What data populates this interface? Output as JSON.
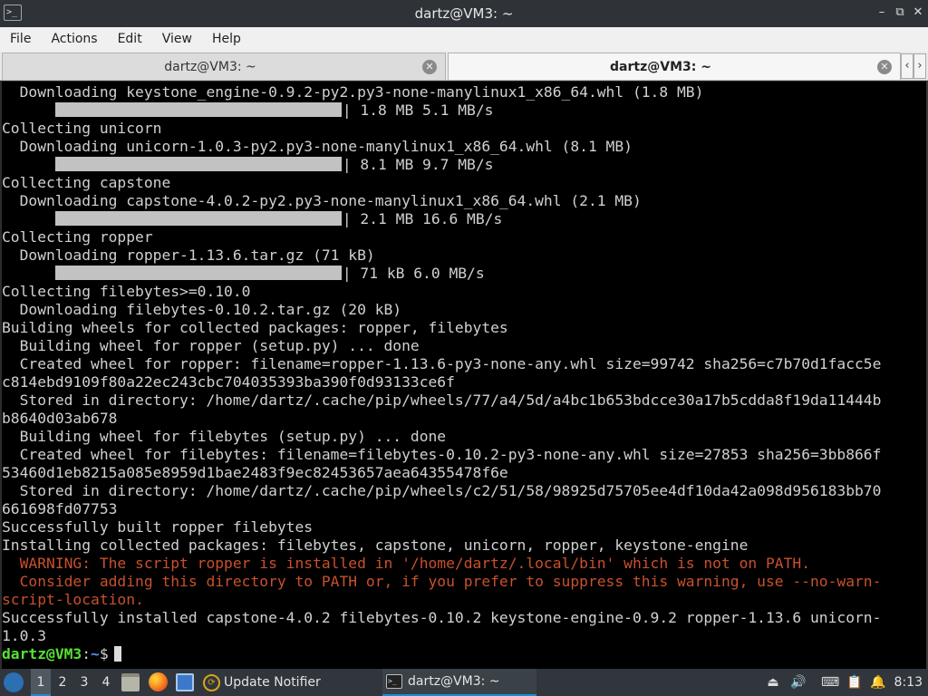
{
  "window": {
    "title": "dartz@VM3: ~",
    "controls": {
      "minimize": "–",
      "maximize": "⧉",
      "close": "✕"
    }
  },
  "menu": [
    "File",
    "Actions",
    "Edit",
    "View",
    "Help"
  ],
  "tabs": [
    {
      "label": "dartz@VM3: ~",
      "active": false
    },
    {
      "label": "dartz@VM3: ~",
      "active": true
    }
  ],
  "tab_nav": {
    "left": "‹",
    "right": "›"
  },
  "terminal": {
    "colors": {
      "background": "#000000",
      "text": "#d0d0d0",
      "warning": "#c8512b",
      "prompt_user": "#55e233",
      "prompt_path": "#5b8ef7"
    },
    "lines": [
      {
        "text": "  Downloading keystone_engine-0.9.2-py2.py3-none-manylinux1_x86_64.whl (1.8 MB)"
      },
      {
        "indent": "      ",
        "progress": 1.0,
        "text": "| 1.8 MB 5.1 MB/s"
      },
      {
        "text": "Collecting unicorn"
      },
      {
        "text": "  Downloading unicorn-1.0.3-py2.py3-none-manylinux1_x86_64.whl (8.1 MB)"
      },
      {
        "indent": "      ",
        "progress": 1.0,
        "text": "| 8.1 MB 9.7 MB/s"
      },
      {
        "text": "Collecting capstone"
      },
      {
        "text": "  Downloading capstone-4.0.2-py2.py3-none-manylinux1_x86_64.whl (2.1 MB)"
      },
      {
        "indent": "      ",
        "progress": 1.0,
        "text": "| 2.1 MB 16.6 MB/s"
      },
      {
        "text": "Collecting ropper"
      },
      {
        "text": "  Downloading ropper-1.13.6.tar.gz (71 kB)"
      },
      {
        "indent": "      ",
        "progress": 1.0,
        "text": "| 71 kB 6.0 MB/s"
      },
      {
        "text": "Collecting filebytes>=0.10.0"
      },
      {
        "text": "  Downloading filebytes-0.10.2.tar.gz (20 kB)"
      },
      {
        "text": "Building wheels for collected packages: ropper, filebytes"
      },
      {
        "text": "  Building wheel for ropper (setup.py) ... done"
      },
      {
        "text": "  Created wheel for ropper: filename=ropper-1.13.6-py3-none-any.whl size=99742 sha256=c7b70d1facc5e"
      },
      {
        "text": "c814ebd9109f80a22ec243cbc704035393ba390f0d93133ce6f"
      },
      {
        "text": "  Stored in directory: /home/dartz/.cache/pip/wheels/77/a4/5d/a4bc1b653bdcce30a17b5cdda8f19da11444b"
      },
      {
        "text": "b8640d03ab678"
      },
      {
        "text": "  Building wheel for filebytes (setup.py) ... done"
      },
      {
        "text": "  Created wheel for filebytes: filename=filebytes-0.10.2-py3-none-any.whl size=27853 sha256=3bb866f"
      },
      {
        "text": "53460d1eb8215a085e8959d1bae2483f9ec82453657aea64355478f6e"
      },
      {
        "text": "  Stored in directory: /home/dartz/.cache/pip/wheels/c2/51/58/98925d75705ee4df10da42a098d956183bb70"
      },
      {
        "text": "661698fd07753"
      },
      {
        "text": "Successfully built ropper filebytes"
      },
      {
        "text": "Installing collected packages: filebytes, capstone, unicorn, ropper, keystone-engine"
      },
      {
        "type": "warning",
        "text": "  WARNING: The script ropper is installed in '/home/dartz/.local/bin' which is not on PATH."
      },
      {
        "type": "warning",
        "text": "  Consider adding this directory to PATH or, if you prefer to suppress this warning, use --no-warn-"
      },
      {
        "type": "warning",
        "text": "script-location."
      },
      {
        "text": "Successfully installed capstone-4.0.2 filebytes-0.10.2 keystone-engine-0.9.2 ropper-1.13.6 unicorn-"
      },
      {
        "text": "1.0.3"
      }
    ],
    "prompt": {
      "user_host": "dartz@VM3",
      "separator": ":",
      "path": "~",
      "symbol": "$"
    }
  },
  "taskbar": {
    "workspaces": [
      "1",
      "2",
      "3",
      "4"
    ],
    "active_workspace": "1",
    "launchers": [
      "file-manager-icon",
      "firefox-icon",
      "show-desktop-icon"
    ],
    "apps": [
      {
        "label": "Update Notifier",
        "icon": "update-notifier-icon"
      },
      {
        "label": "dartz@VM3: ~",
        "icon": "terminal-icon",
        "active": true
      }
    ],
    "tray": [
      "eject-icon",
      "volume-icon",
      "keyboard-icon",
      "clipboard-icon",
      "notifications-icon"
    ],
    "clock": "8:13"
  }
}
